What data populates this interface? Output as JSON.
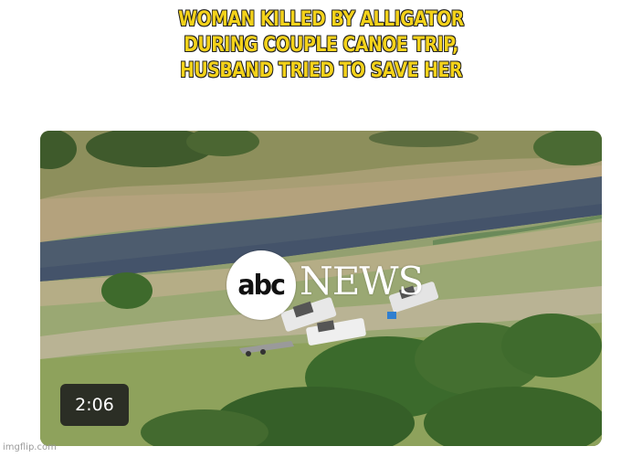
{
  "caption": {
    "lines": [
      "WOMAN KILLED BY ALLIGATOR",
      "DURING COUPLE CANOE TRIP,",
      "HUSBAND TRIED TO SAVE HER"
    ],
    "color": "#f4d21a"
  },
  "video": {
    "logo_text": "abc",
    "news_text": "NEWS",
    "duration": "2:06"
  },
  "watermark": "imgflip.com"
}
